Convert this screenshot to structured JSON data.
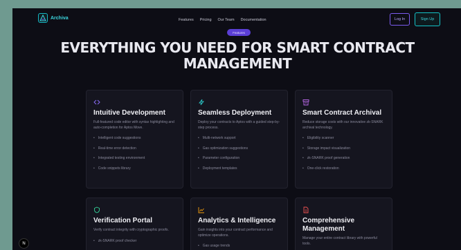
{
  "header": {
    "brand": "Archiva",
    "nav": [
      "Features",
      "Pricing",
      "Our Team",
      "Documentation"
    ],
    "login_label": "Log In",
    "signup_label": "Sign Up"
  },
  "hero": {
    "badge": "Features",
    "title": "EVERYTHING YOU NEED FOR SMART CONTRACT MANAGEMENT"
  },
  "cards": [
    {
      "icon": "code-icon",
      "title": "Intuitive Development",
      "desc": "Full-featured code editor with syntax highlighting and auto-completion for Aptos Move.",
      "items": [
        "Intelligent code suggestions",
        "Real-time error detection",
        "Integrated testing environment",
        "Code snippets library"
      ]
    },
    {
      "icon": "lightning-icon",
      "title": "Seamless Deployment",
      "desc": "Deploy your contracts to Aptos with a guided step-by-step process.",
      "items": [
        "Multi-network support",
        "Gas optimization suggestions",
        "Parameter configuration",
        "Deployment templates"
      ]
    },
    {
      "icon": "archive-icon",
      "title": "Smart Contract Archival",
      "desc": "Reduce storage costs with our innovative zk-SNARK archival technology.",
      "items": [
        "Eligibility scanner",
        "Storage impact visualization",
        "zk-SNARK proof generation",
        "One-click restoration"
      ]
    },
    {
      "icon": "shield-icon",
      "title": "Verification Portal",
      "desc": "Verify contract integrity with cryptographic proofs.",
      "items": [
        "zk-SNARK proof checker"
      ]
    },
    {
      "icon": "chart-icon",
      "title": "Analytics & Intelligence",
      "desc": "Gain insights into your contract performance and optimize operations.",
      "items": [
        "Gas usage trends"
      ]
    },
    {
      "icon": "document-icon",
      "title": "Comprehensive Management",
      "desc": "Manage your entire contract library with powerful tools.",
      "items": []
    }
  ],
  "colors": {
    "accent_teal": "#14b8c4",
    "accent_purple": "#7c5cf0",
    "background": "#0d0d15",
    "card": "#15151f"
  },
  "dev_badge": "N"
}
